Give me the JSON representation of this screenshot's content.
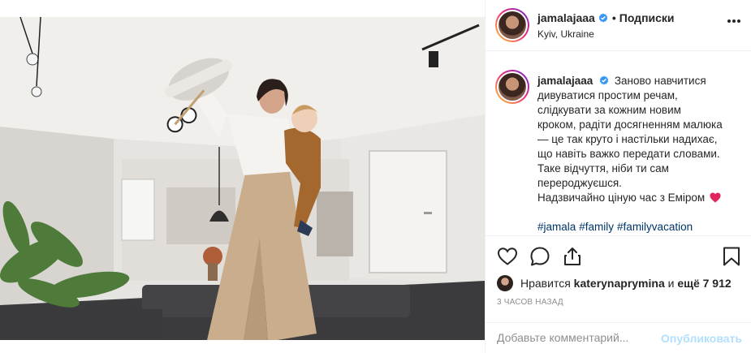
{
  "post": {
    "username": "jamalajaaa",
    "separator": "•",
    "follow_label": "Подписки",
    "location": "Kyiv, Ukraine",
    "caption_lines": [
      "Заново навчитися",
      "дивуватися простим речам,",
      "слідкувати за кожним новим",
      "кроком, радіти досягненням малюка",
      "— це так круто і настільки надихає,",
      "що навіть важко передати словами.",
      "Таке відчуття, ніби ти сам",
      "перероджуєшся.",
      "Надзвичайно ціную час з Еміром"
    ],
    "hashtags": [
      "#jamala",
      "#family",
      "#familyvacation"
    ],
    "likes": {
      "prefix": "Нравится",
      "liker": "katerynaprymina",
      "suffix_and": "и",
      "others": "ещё 7 912"
    },
    "time_ago": "3 часов назад",
    "comment_placeholder": "Добавьте комментарий...",
    "publish_label": "Опубликовать"
  },
  "icons": {
    "verified": "verified-badge-icon",
    "more": "more-options-icon",
    "like": "heart-icon",
    "comment": "comment-icon",
    "share": "share-icon",
    "save": "bookmark-icon",
    "emoji": "red-heart-emoji"
  },
  "colors": {
    "verified_blue": "#3897f0",
    "hashtag": "#003569",
    "muted": "#8e8e8e",
    "publish_disabled": "#b2dffc",
    "heart_red": "#e0245e"
  }
}
